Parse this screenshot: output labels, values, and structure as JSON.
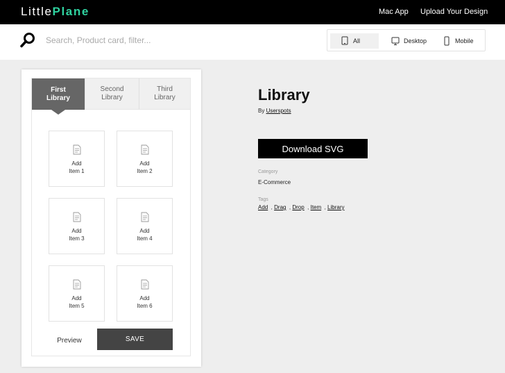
{
  "header": {
    "logo_light": "Little",
    "logo_bold": "Plane",
    "nav": [
      "Mac App",
      "Upload Your Design"
    ]
  },
  "search": {
    "placeholder": "Search, Product card, filter..."
  },
  "device_filter": {
    "options": [
      "All",
      "Desktop",
      "Mobile"
    ],
    "selected": "All"
  },
  "widget": {
    "tabs": [
      {
        "line1": "First",
        "line2": "Library",
        "active": true
      },
      {
        "line1": "Second",
        "line2": "Library",
        "active": false
      },
      {
        "line1": "Third",
        "line2": "Library",
        "active": false
      }
    ],
    "items": [
      {
        "line1": "Add",
        "line2": "Item 1"
      },
      {
        "line1": "Add",
        "line2": "Item 2"
      },
      {
        "line1": "Add",
        "line2": "Item 3"
      },
      {
        "line1": "Add",
        "line2": "Item 4"
      },
      {
        "line1": "Add",
        "line2": "Item 5"
      },
      {
        "line1": "Add",
        "line2": "Item 6"
      }
    ],
    "preview_label": "Preview",
    "save_label": "SAVE"
  },
  "info": {
    "title": "Library",
    "by_prefix": "By",
    "author": "Userspots",
    "download_label": "Download SVG",
    "category_label": "Category",
    "category": "E-Commerce",
    "tags_label": "Tags",
    "tags": [
      "Add",
      "Drag",
      "Drop",
      "Item",
      "Library"
    ]
  },
  "colors": {
    "accent": "#2fd3a0",
    "header_bg": "#000000",
    "active_tab": "#666666",
    "save_button": "#444444"
  }
}
